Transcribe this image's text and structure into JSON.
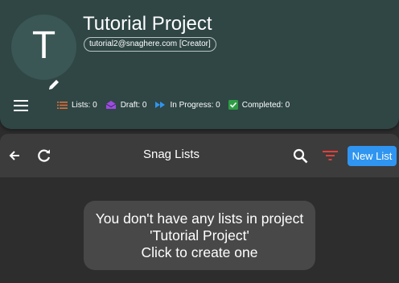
{
  "project": {
    "avatar_letter": "T",
    "title": "Tutorial Project",
    "owner_chip": "tutorial2@snaghere.com [Creator]"
  },
  "stats": [
    {
      "label": "Lists: 0",
      "icon": "list-icon",
      "color": "#e0703a"
    },
    {
      "label": "Draft: 0",
      "icon": "draft-envelope-icon",
      "color": "#9c4be0"
    },
    {
      "label": "In Progress: 0",
      "icon": "fast-forward-icon",
      "color": "#2f95f0"
    },
    {
      "label": "Completed: 0",
      "icon": "check-box-icon",
      "color": "#2e9c44"
    }
  ],
  "toolbar": {
    "title": "Snag Lists",
    "new_list_label": "New List"
  },
  "empty_state": {
    "line1": "You don't have any lists in project",
    "line2": "'Tutorial Project'",
    "line3": "Click to create one"
  },
  "colors": {
    "header_bg": "#2f4645",
    "accent": "#2f95f0",
    "filter_icon": "#e0403a"
  }
}
